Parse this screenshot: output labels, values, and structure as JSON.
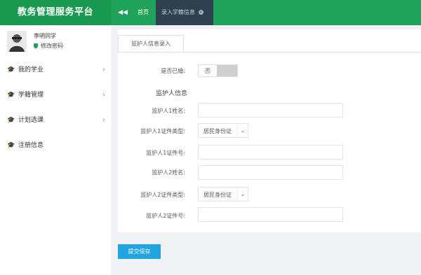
{
  "header": {
    "app_title": "教务管理服务平台",
    "collapse_icon": "double-chevron-left-icon",
    "tabs": [
      {
        "label": "首页"
      },
      {
        "label": "录入学籍信息"
      }
    ]
  },
  "sidebar": {
    "user_name": "李明同学",
    "user_action": "修改密码",
    "items": [
      {
        "label": "我的学业",
        "icon": "graduation-cap-icon",
        "has_arrow": true
      },
      {
        "label": "学籍管理",
        "icon": "graduation-cap-icon",
        "has_arrow": true
      },
      {
        "label": "计划选课",
        "icon": "graduation-cap-icon",
        "has_arrow": true
      },
      {
        "label": "注册信息",
        "icon": "graduation-cap-icon",
        "has_arrow": false
      }
    ]
  },
  "form": {
    "tab_label": "监护人信息录入",
    "toggle_label": "是否已婚:",
    "toggle_value": "否",
    "section_title": "监护人信息",
    "fields": [
      {
        "label": "监护人1姓名:"
      },
      {
        "label": "监护人1证件类型:",
        "value": "居民身份证"
      },
      {
        "label": "监护人1证件号:"
      },
      {
        "label": "监护人2姓名:"
      },
      {
        "label": "监护人2证件类型:",
        "value": "居民身份证"
      },
      {
        "label": "监护人2证件号:"
      }
    ]
  },
  "actions": {
    "submit_label": "提交保存"
  },
  "colors": {
    "topbar": "#1fa35a",
    "active_tab": "#2f4050",
    "submit": "#21a4df"
  }
}
